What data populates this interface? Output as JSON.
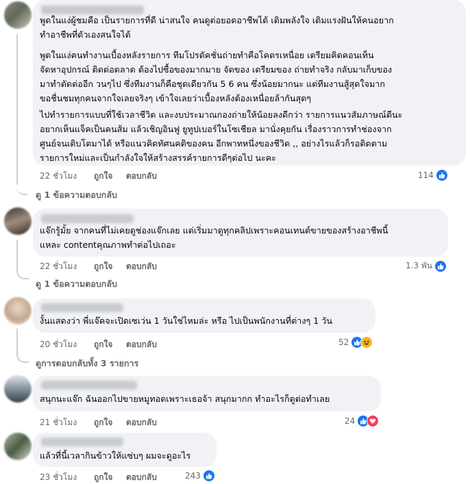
{
  "comments": [
    {
      "paragraphs": [
        [
          "พูดในแง่ผู้ชมคือ เป็นรายการที่ดี น่าสนใจ คนดูต่อยอดอาชีพได้ เติมพลังใจ เติมแรงฝันให้คนอยาก",
          "ทำอาชีพที่ตัวเองสนใจได้"
        ],
        [
          "พูดในแง่คนทำงานเบื้องหลังรายการ ทีมโปรดัคชั่นถ่ายทำคือโคตรเหนื่อย เตรียมคิดคอนเท็น",
          "จัดหาอุปกรณ์ ติดต่อตลาด ต้องไปซื้อของมากมาย จัดของ เตรียมของ ถ่ายทำจริง กลับมาเก็บของ",
          "มาทำตัดต่ออีก วนๆไป ซึ่งทีมงานก็คือชุดเดียวกัน 5 6 คน ซึ่งน้อยมากนะ แต่ทีมงานสู้สุดใจมาก",
          "ขอชื่นชมทุกคนจากใจเลยจริงๆ เข้าใจเลยว่าเบื้องหลังต้องเหนื่อยล้ากันสุดๆ"
        ],
        [
          "ไปทำรายการแบบที่ใช้เวลาชีวิต และงบประมาณกองถ่ายให้น้อยลงดีกว่า รายการแนวสัมภาษณ์ดีนะ",
          "อยากเห็นแจ็คเป็นคนส้ม แล้วเชิญอินฟู ยูทูปเบอร์ในโซเชียล มานั่งคุยกัน เรื่องราวการทำช่องจาก",
          "ศูนย์จนเติบโตมาได้ หรือแนวคิดทัศนคติของคน อีกพาทหนึ่งของชีวิต ,, อย่างไรแล้วก็รอติดตาม",
          "รายการใหม่และเป็นกำลังใจให้สร้างสรรค์รายการดีๆต่อไป นะคะ"
        ]
      ],
      "time": "22 ชั่วโมง",
      "like": "ถูกใจ",
      "reply": "ตอบกลับ",
      "reaction_count": "114",
      "replies_link": "ดู 1 ข้อความตอบกลับ"
    },
    {
      "paragraphs": [
        [
          "แจ๊กรู้มั้ย จากคนที่ไม่เคยดูช่องแจ๊กเลย แต่เริ่มมาดูทุกคลิปเพราะคอนเทนต์ขายของสร้างอาชีพนี้",
          "แหละ contentคุณภาพทำต่อไปเถอะ"
        ]
      ],
      "time": "22 ชั่วโมง",
      "like": "ถูกใจ",
      "reply": "ตอบกลับ",
      "reaction_count": "1.3 พัน",
      "replies_link": "ดู 1 ข้อความตอบกลับ"
    },
    {
      "paragraphs": [
        [
          "งั้นแสดงว่า พี่แจ๊คจะเปิดเซเว่น 1 วันใช่ไหมล่ะ หรือ ไปเป็นพนักงานที่ต่างๆ 1 วัน"
        ]
      ],
      "time": "20 ชั่วโมง",
      "like": "ถูกใจ",
      "reply": "ตอบกลับ",
      "reaction_count": "52",
      "replies_link": "ดูการตอบกลับทั้ง 3 รายการ"
    },
    {
      "paragraphs": [
        [
          "สนุกนะแจ๊ก ฉันออกไปขายหมูทอดเพราะเธอจ้า สนุกมากก ทำอะไรก็ดูต่อทำเลย"
        ]
      ],
      "time": "21 ชั่วโมง",
      "like": "ถูกใจ",
      "reply": "ตอบกลับ",
      "reaction_count": "24"
    },
    {
      "paragraphs": [
        [
          "แล้วที่นี้เวลากินข้าวให้แซ่บๆ ผมจะดูอะไร"
        ]
      ],
      "time": "23 ชั่วโมง",
      "like": "ถูกใจ",
      "reply": "ตอบกลับ",
      "reaction_count": "243"
    }
  ],
  "icons": {
    "like": "like-reaction-icon",
    "haha": "haha-reaction-icon",
    "love": "love-reaction-icon"
  },
  "colors": {
    "bubble": "#f0f2f5",
    "meta": "#65676b",
    "like_blue": "#1877f2",
    "love_red": "#f33e58",
    "haha_yellow": "#f7b125"
  }
}
